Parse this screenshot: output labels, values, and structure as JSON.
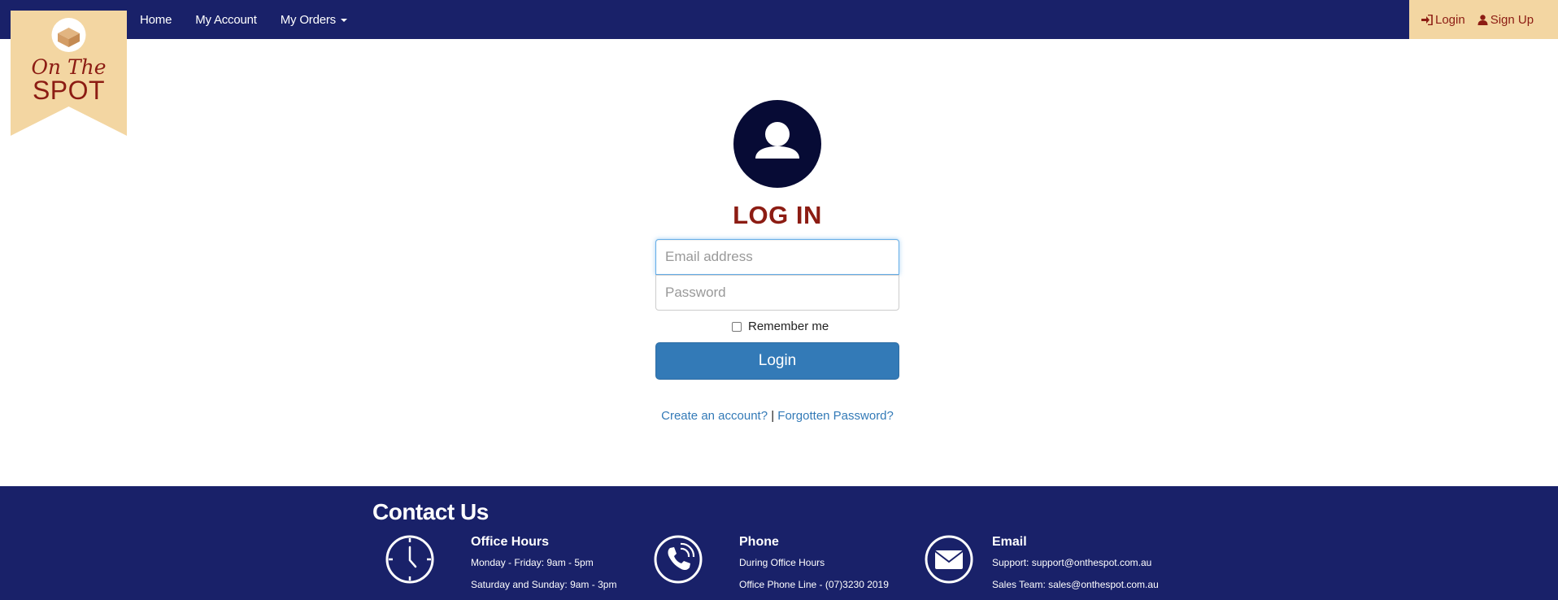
{
  "brand": {
    "script_text": "On The",
    "main_text": "SPOT",
    "colors": {
      "navy": "#192169",
      "cream": "#f3d6a2",
      "maroon": "#8c1c13",
      "blue": "#337ab7"
    }
  },
  "nav": {
    "items": [
      {
        "label": "Home"
      },
      {
        "label": "My Account"
      },
      {
        "label": "My Orders"
      }
    ],
    "right": {
      "login_label": "Login",
      "signup_label": "Sign Up"
    }
  },
  "login": {
    "title": "LOG IN",
    "email_placeholder": "Email address",
    "password_placeholder": "Password",
    "remember_label": "Remember me",
    "button_label": "Login",
    "create_account": "Create an account?",
    "separator": "|",
    "forgot_password": "Forgotten Password?"
  },
  "footer": {
    "title": "Contact Us",
    "office_hours": {
      "icon": "clock-icon",
      "heading": "Office Hours",
      "lines": [
        "Monday - Friday: 9am - 5pm",
        "Saturday and Sunday: 9am - 3pm"
      ]
    },
    "phone": {
      "icon": "phone-icon",
      "heading": "Phone",
      "lines": [
        "During Office Hours",
        "Office Phone Line - (07)3230 2019"
      ]
    },
    "email": {
      "icon": "envelope-icon",
      "heading": "Email",
      "lines": [
        "Support: support@onthespot.com.au",
        "Sales Team: sales@onthespot.com.au"
      ]
    }
  }
}
